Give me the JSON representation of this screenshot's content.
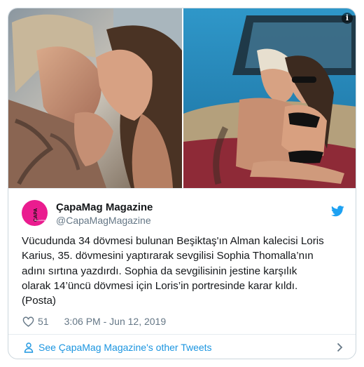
{
  "author": {
    "display_name": "ÇapaMag Magazine",
    "handle": "@CapaMagMagazine",
    "avatar_mark": "ÇAPA",
    "avatar_sub": "MAGAZINE"
  },
  "tweet": {
    "lines": [
      "Vücudunda 34 dövmesi bulunan Beşiktaş'ın Alman kalecisi Loris",
      "Karius, 35. dövmesini yaptırarak sevgilisi Sophia Thomalla’nın",
      "adını sırtına yazdırdı. Sophia da sevgilisinin jestine karşılık",
      "olarak 14’üncü dövmesi için Loris’in portresinde karar kıldı.",
      "(Posta)"
    ],
    "likes": "51",
    "timestamp": "3:06 PM - Jun 12, 2019"
  },
  "media": {
    "info_badge": "i"
  },
  "footer": {
    "label": "See ÇapaMag Magazine's other Tweets"
  },
  "colors": {
    "link": "#1b95e0",
    "twitter_blue": "#1da1f2",
    "avatar_bg": "#ea1c8f",
    "secondary_text": "#657786",
    "border": "#ccd6dd"
  },
  "icons": [
    "info-icon",
    "twitter-bird-icon",
    "heart-icon",
    "person-icon",
    "chevron-right-icon"
  ]
}
